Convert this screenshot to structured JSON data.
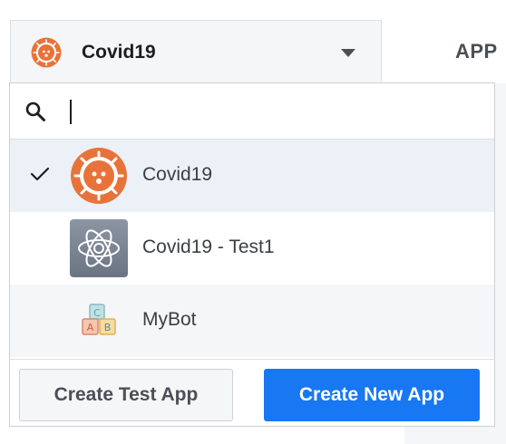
{
  "header": {
    "selected_app": "Covid19",
    "right_label": "APP"
  },
  "search": {
    "placeholder": "",
    "value": ""
  },
  "apps": [
    {
      "name": "Covid19",
      "selected": true,
      "icon": "virus-app-icon"
    },
    {
      "name": "Covid19 - Test1",
      "selected": false,
      "icon": "atom-app-icon"
    },
    {
      "name": "MyBot",
      "selected": false,
      "icon": "blocks-app-icon"
    }
  ],
  "footer": {
    "create_test_label": "Create Test App",
    "create_new_label": "Create New App"
  },
  "colors": {
    "primary": "#1877f2",
    "virus_orange": "#e8733a",
    "selected_row": "#ecf0f7"
  }
}
